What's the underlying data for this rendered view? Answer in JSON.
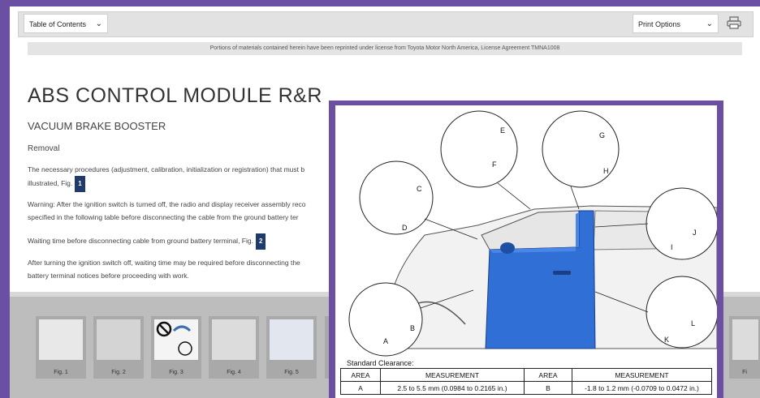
{
  "toolbar": {
    "toc_label": "Table of Contents",
    "print_label": "Print Options"
  },
  "license_text": "Portions of materials contained herein have been reprinted under license from Toyota Motor North America, License Agreement TMNA1008",
  "article": {
    "title": "ABS CONTROL MODULE R&R",
    "subtitle": "VACUUM BRAKE BOOSTER",
    "section": "Removal",
    "p1_a": "The necessary procedures (adjustment, calibration, initialization or registration) that must b",
    "p1_b": "illustrated, Fig.",
    "p1_fig": "1",
    "p2_a": "Warning: After the ignition switch is turned off, the radio and display receiver assembly reco",
    "p2_b": "specified in the following table before disconnecting the cable from the ground battery ter",
    "p3": "Waiting time before disconnecting cable from ground battery terminal, Fig.",
    "p3_fig": "2",
    "p4_a": "After turning the ignition switch off, waiting time may be required before disconnecting the",
    "p4_b": "battery terminal notices before proceeding with work."
  },
  "gallery": [
    {
      "label": "Fig. 1"
    },
    {
      "label": "Fig. 2"
    },
    {
      "label": "Fig. 3"
    },
    {
      "label": "Fig. 4"
    },
    {
      "label": "Fig. 5"
    }
  ],
  "gallery_last_label": "Fi",
  "figure": {
    "callouts": [
      "A",
      "B",
      "C",
      "D",
      "E",
      "F",
      "G",
      "H",
      "I",
      "J",
      "K",
      "L"
    ],
    "standard_clearance_label": "Standard Clearance:",
    "table": {
      "headers": [
        "AREA",
        "MEASUREMENT",
        "AREA",
        "MEASUREMENT"
      ],
      "rows": [
        [
          "A",
          "2.5 to 5.5 mm (0.0984 to 0.2165 in.)",
          "B",
          "-1.8 to 1.2 mm (-0.0709 to 0.0472 in.)"
        ]
      ]
    }
  },
  "colors": {
    "frame": "#6b4fa3",
    "door_blue": "#2f6fd6",
    "badge": "#1f3b6b"
  }
}
